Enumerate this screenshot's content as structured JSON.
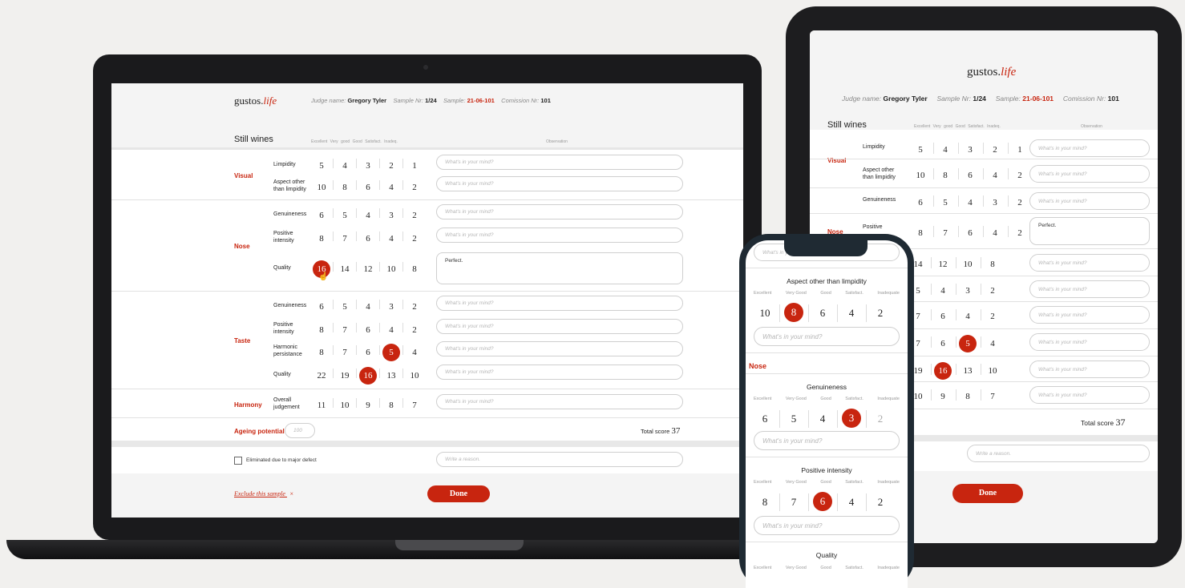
{
  "app": {
    "logo_main": "gustos.",
    "logo_accent": "life"
  },
  "judge": {
    "label": "Judge name:",
    "name": "Gregory Tyler"
  },
  "sample_nr": {
    "label": "Sample Nr:",
    "value": "1/24"
  },
  "sample": {
    "label": "Sample:",
    "value": "21-06-101"
  },
  "commission": {
    "label": "Comission Nr:",
    "value": "101"
  },
  "category": "Still wines",
  "columns": [
    "Excellent",
    "Very good",
    "Good",
    "Satisfact.",
    "Inadeq."
  ],
  "observation_header": "Observation",
  "observation_placeholder": "What's in your mind?",
  "sections": {
    "visual": "Visual",
    "nose": "Nose",
    "taste": "Taste",
    "harmony": "Harmony"
  },
  "criteria": {
    "limpidity": "Limpidity",
    "aspect_1": "Aspect other",
    "aspect_2": "than limpidity",
    "genuineness": "Genuineness",
    "pos_1": "Positive",
    "pos_2": "intensity",
    "quality": "Quality",
    "harm_1": "Harmonic",
    "harm_2": "persistance",
    "overall_1": "Overall",
    "overall_2": "judgement"
  },
  "scores": {
    "visual_limpidity": [
      "5",
      "4",
      "3",
      "2",
      "1"
    ],
    "visual_aspect": [
      "10",
      "8",
      "6",
      "4",
      "2"
    ],
    "nose_genuineness": [
      "6",
      "5",
      "4",
      "3",
      "2"
    ],
    "nose_positive": [
      "8",
      "7",
      "6",
      "4",
      "2"
    ],
    "nose_quality": [
      "16",
      "14",
      "12",
      "10",
      "8"
    ],
    "taste_genuineness": [
      "6",
      "5",
      "4",
      "3",
      "2"
    ],
    "taste_positive": [
      "8",
      "7",
      "6",
      "4",
      "2"
    ],
    "taste_harmonic": [
      "8",
      "7",
      "6",
      "5",
      "4"
    ],
    "taste_quality": [
      "22",
      "19",
      "16",
      "13",
      "10"
    ],
    "harmony_overall": [
      "11",
      "10",
      "9",
      "8",
      "7"
    ]
  },
  "nose_quality_note": "Perfect.",
  "ageing": {
    "label": "Ageing potential",
    "placeholder": "100"
  },
  "total": {
    "label": "Total score",
    "value": "37"
  },
  "eliminated": {
    "label": "Eliminated due to major defect",
    "placeholder": "Write a reason."
  },
  "exclude": {
    "label": "Exclude this sample",
    "icon": "×"
  },
  "done_label": "Done",
  "mobile": {
    "top_placeholder": "What's in your mind?",
    "aspect_title": "Aspect other than limpidity",
    "cols": [
      "Excellent",
      "Very Good",
      "Good",
      "Satisfact.",
      "Inadequate"
    ],
    "aspect_scores": [
      "10",
      "8",
      "6",
      "4",
      "2"
    ],
    "nose_label": "Nose",
    "genuineness_title": "Genuineness",
    "genuineness_scores": [
      "6",
      "5",
      "4",
      "3",
      "2"
    ],
    "positive_title": "Positive intensity",
    "positive_scores": [
      "8",
      "7",
      "6",
      "4",
      "2"
    ],
    "quality_title": "Quality"
  },
  "tablet": {
    "eliminated_fragment": "fect",
    "reason_placeholder": "Write a reason."
  },
  "colors": {
    "accent": "#c8250f",
    "bezel": "#1d1d1f",
    "background": "#f1f0ee"
  }
}
